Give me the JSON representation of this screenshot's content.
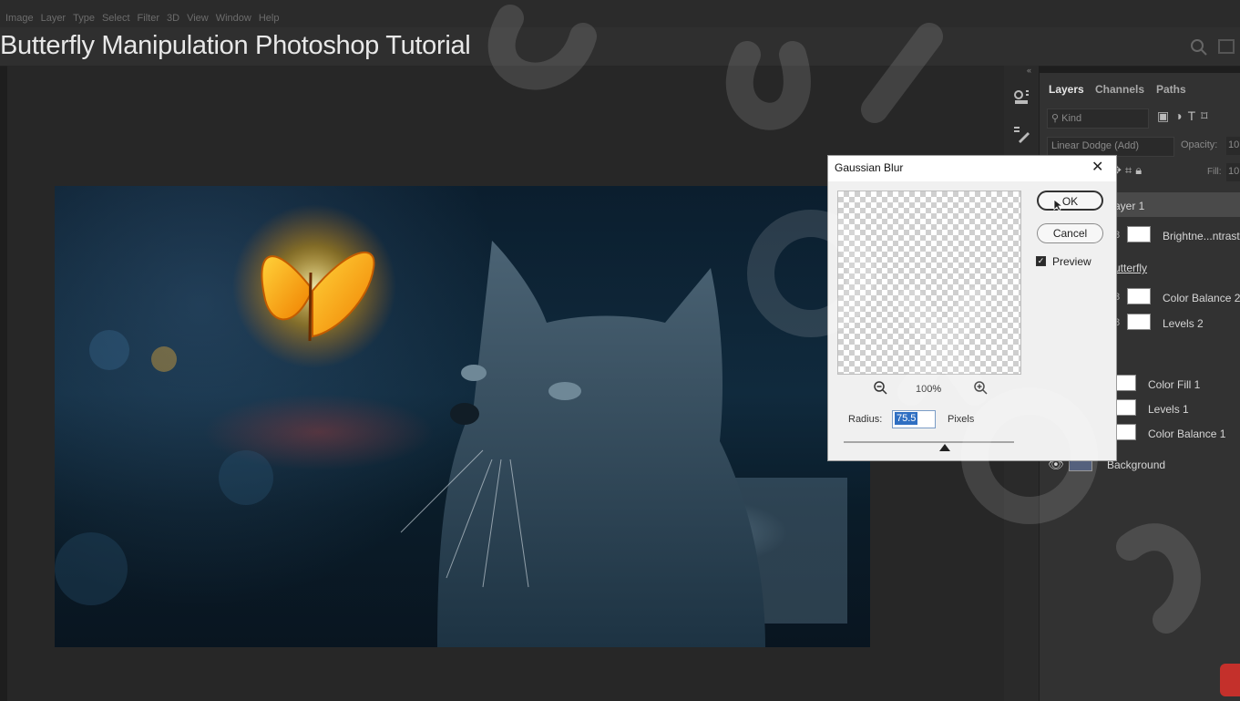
{
  "menu": {
    "items": [
      "Image",
      "Layer",
      "Type",
      "Select",
      "Filter",
      "3D",
      "View",
      "Window",
      "Help"
    ]
  },
  "overlay_title": "Butterfly Manipulation Photoshop Tutorial",
  "layers_panel": {
    "tabs": [
      "Layers",
      "Channels",
      "Paths"
    ],
    "kind_placeholder": "Kind",
    "blend_mode": "Linear Dodge (Add)",
    "opacity_label": "Opacity:",
    "opacity_value": "10",
    "fill_label": "Fill:",
    "fill_value": "10",
    "layers": [
      {
        "name": "ayer 1",
        "selected": true
      },
      {
        "name": "Brightne...ntrast"
      },
      {
        "name": "utterfly"
      },
      {
        "name": "Color Balance 2"
      },
      {
        "name": "Levels 2"
      },
      {
        "name": "Color Fill 1"
      },
      {
        "name": "Levels 1"
      },
      {
        "name": "Color Balance 1"
      },
      {
        "name": "Background"
      }
    ]
  },
  "dialog": {
    "title": "Gaussian Blur",
    "close_symbol": "✕",
    "ok_label": "OK",
    "cancel_label": "Cancel",
    "preview_label": "Preview",
    "preview_checked": true,
    "zoom_level": "100%",
    "radius_label": "Radius:",
    "radius_value": "75.5",
    "units_label": "Pixels"
  },
  "icons": {
    "search": "search-icon",
    "zoom_out": "zoom-out-icon",
    "zoom_in": "zoom-in-icon",
    "visibility": "eye-icon"
  },
  "colors": {
    "accent": "#2f6fc2",
    "panel_bg": "#323232",
    "dialog_bg": "#f0f0f0",
    "youtube_red": "#c4302b"
  }
}
